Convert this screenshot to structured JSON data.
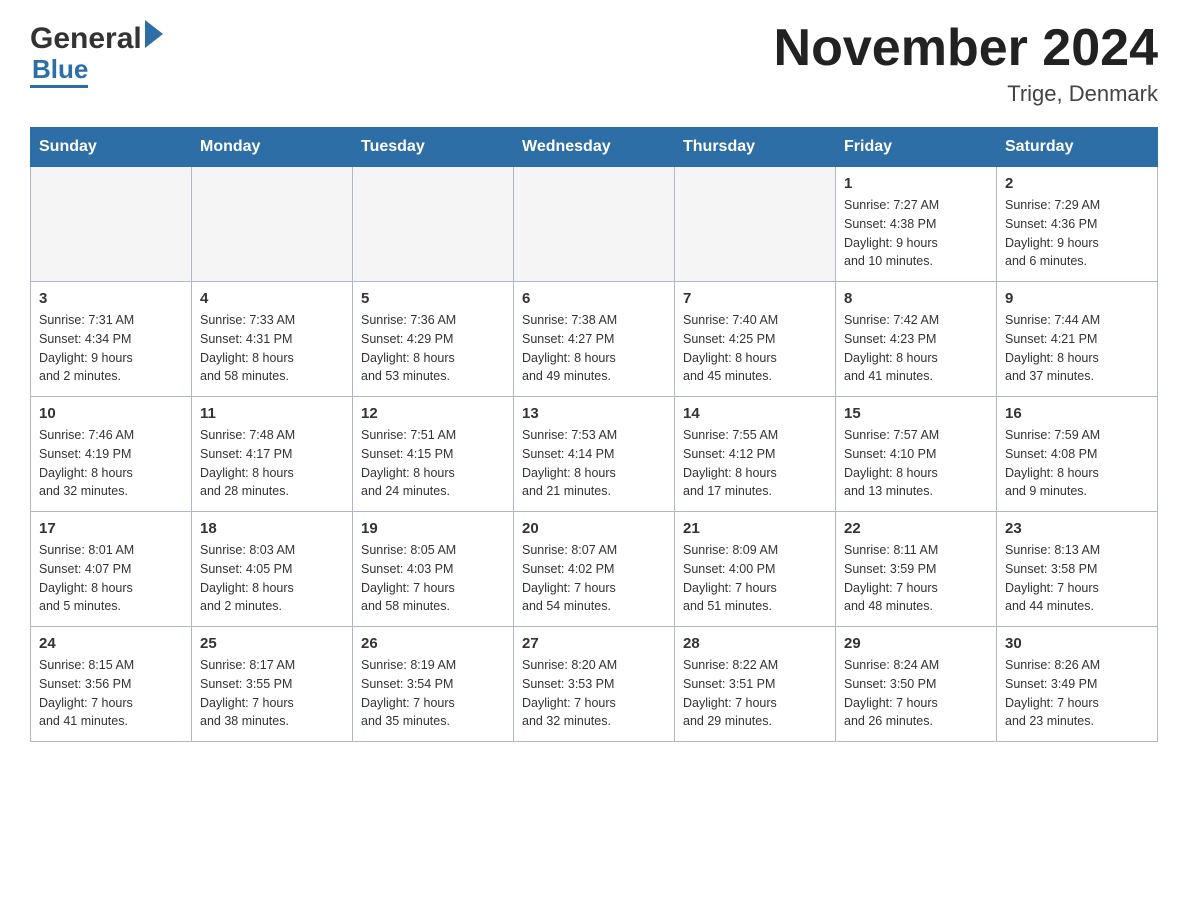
{
  "header": {
    "logo_general": "General",
    "logo_blue": "Blue",
    "month_title": "November 2024",
    "location": "Trige, Denmark"
  },
  "weekdays": [
    "Sunday",
    "Monday",
    "Tuesday",
    "Wednesday",
    "Thursday",
    "Friday",
    "Saturday"
  ],
  "weeks": [
    [
      {
        "day": "",
        "info": ""
      },
      {
        "day": "",
        "info": ""
      },
      {
        "day": "",
        "info": ""
      },
      {
        "day": "",
        "info": ""
      },
      {
        "day": "",
        "info": ""
      },
      {
        "day": "1",
        "info": "Sunrise: 7:27 AM\nSunset: 4:38 PM\nDaylight: 9 hours\nand 10 minutes."
      },
      {
        "day": "2",
        "info": "Sunrise: 7:29 AM\nSunset: 4:36 PM\nDaylight: 9 hours\nand 6 minutes."
      }
    ],
    [
      {
        "day": "3",
        "info": "Sunrise: 7:31 AM\nSunset: 4:34 PM\nDaylight: 9 hours\nand 2 minutes."
      },
      {
        "day": "4",
        "info": "Sunrise: 7:33 AM\nSunset: 4:31 PM\nDaylight: 8 hours\nand 58 minutes."
      },
      {
        "day": "5",
        "info": "Sunrise: 7:36 AM\nSunset: 4:29 PM\nDaylight: 8 hours\nand 53 minutes."
      },
      {
        "day": "6",
        "info": "Sunrise: 7:38 AM\nSunset: 4:27 PM\nDaylight: 8 hours\nand 49 minutes."
      },
      {
        "day": "7",
        "info": "Sunrise: 7:40 AM\nSunset: 4:25 PM\nDaylight: 8 hours\nand 45 minutes."
      },
      {
        "day": "8",
        "info": "Sunrise: 7:42 AM\nSunset: 4:23 PM\nDaylight: 8 hours\nand 41 minutes."
      },
      {
        "day": "9",
        "info": "Sunrise: 7:44 AM\nSunset: 4:21 PM\nDaylight: 8 hours\nand 37 minutes."
      }
    ],
    [
      {
        "day": "10",
        "info": "Sunrise: 7:46 AM\nSunset: 4:19 PM\nDaylight: 8 hours\nand 32 minutes."
      },
      {
        "day": "11",
        "info": "Sunrise: 7:48 AM\nSunset: 4:17 PM\nDaylight: 8 hours\nand 28 minutes."
      },
      {
        "day": "12",
        "info": "Sunrise: 7:51 AM\nSunset: 4:15 PM\nDaylight: 8 hours\nand 24 minutes."
      },
      {
        "day": "13",
        "info": "Sunrise: 7:53 AM\nSunset: 4:14 PM\nDaylight: 8 hours\nand 21 minutes."
      },
      {
        "day": "14",
        "info": "Sunrise: 7:55 AM\nSunset: 4:12 PM\nDaylight: 8 hours\nand 17 minutes."
      },
      {
        "day": "15",
        "info": "Sunrise: 7:57 AM\nSunset: 4:10 PM\nDaylight: 8 hours\nand 13 minutes."
      },
      {
        "day": "16",
        "info": "Sunrise: 7:59 AM\nSunset: 4:08 PM\nDaylight: 8 hours\nand 9 minutes."
      }
    ],
    [
      {
        "day": "17",
        "info": "Sunrise: 8:01 AM\nSunset: 4:07 PM\nDaylight: 8 hours\nand 5 minutes."
      },
      {
        "day": "18",
        "info": "Sunrise: 8:03 AM\nSunset: 4:05 PM\nDaylight: 8 hours\nand 2 minutes."
      },
      {
        "day": "19",
        "info": "Sunrise: 8:05 AM\nSunset: 4:03 PM\nDaylight: 7 hours\nand 58 minutes."
      },
      {
        "day": "20",
        "info": "Sunrise: 8:07 AM\nSunset: 4:02 PM\nDaylight: 7 hours\nand 54 minutes."
      },
      {
        "day": "21",
        "info": "Sunrise: 8:09 AM\nSunset: 4:00 PM\nDaylight: 7 hours\nand 51 minutes."
      },
      {
        "day": "22",
        "info": "Sunrise: 8:11 AM\nSunset: 3:59 PM\nDaylight: 7 hours\nand 48 minutes."
      },
      {
        "day": "23",
        "info": "Sunrise: 8:13 AM\nSunset: 3:58 PM\nDaylight: 7 hours\nand 44 minutes."
      }
    ],
    [
      {
        "day": "24",
        "info": "Sunrise: 8:15 AM\nSunset: 3:56 PM\nDaylight: 7 hours\nand 41 minutes."
      },
      {
        "day": "25",
        "info": "Sunrise: 8:17 AM\nSunset: 3:55 PM\nDaylight: 7 hours\nand 38 minutes."
      },
      {
        "day": "26",
        "info": "Sunrise: 8:19 AM\nSunset: 3:54 PM\nDaylight: 7 hours\nand 35 minutes."
      },
      {
        "day": "27",
        "info": "Sunrise: 8:20 AM\nSunset: 3:53 PM\nDaylight: 7 hours\nand 32 minutes."
      },
      {
        "day": "28",
        "info": "Sunrise: 8:22 AM\nSunset: 3:51 PM\nDaylight: 7 hours\nand 29 minutes."
      },
      {
        "day": "29",
        "info": "Sunrise: 8:24 AM\nSunset: 3:50 PM\nDaylight: 7 hours\nand 26 minutes."
      },
      {
        "day": "30",
        "info": "Sunrise: 8:26 AM\nSunset: 3:49 PM\nDaylight: 7 hours\nand 23 minutes."
      }
    ]
  ]
}
